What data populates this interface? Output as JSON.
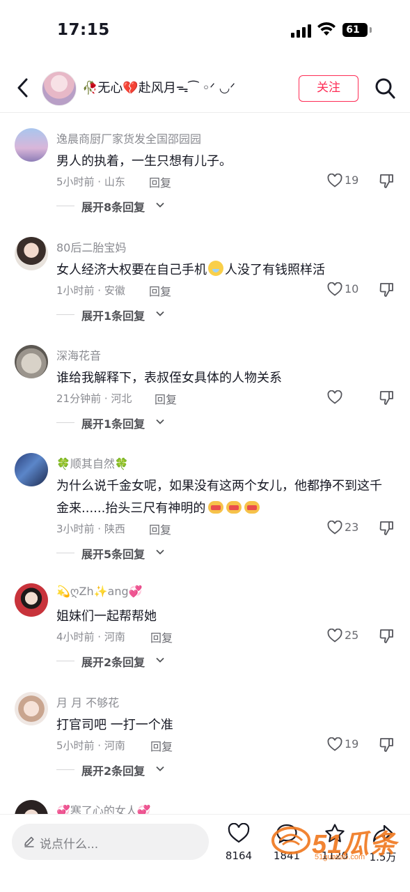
{
  "status_bar": {
    "time": "17:15",
    "battery": "61"
  },
  "header": {
    "user_name": "🥀无心💔赴风月ᯓ⁀ ◦ᐟ ◡ᐟ",
    "follow_label": "关注"
  },
  "comments": [
    {
      "name": "逸晨商厨厂家货发全国邵园园",
      "text": "男人的执着，一生只想有儿子。",
      "meta": "5小时前 · 山东",
      "reply": "回复",
      "likes": "19",
      "expand": "展开8条回复"
    },
    {
      "name": "80后二胎宝妈",
      "text_before": "女人经济大权要在自己手机",
      "text_after": "人没了有钱照样活",
      "meta": "1小时前 · 安徽",
      "reply": "回复",
      "likes": "10",
      "expand": "展开1条回复"
    },
    {
      "name": "深海花音",
      "text": "谁给我解释下，表叔侄女具体的人物关系",
      "meta": "21分钟前 · 河北",
      "reply": "回复",
      "likes": "",
      "expand": "展开1条回复"
    },
    {
      "name": "🍀顺其自然🍀",
      "text": "为什么说千金女呢，如果没有这两个女儿，他都挣不到这千金来......抬头三尺有神明的",
      "meta": "3小时前 · 陕西",
      "reply": "回复",
      "likes": "23",
      "expand": "展开5条回复"
    },
    {
      "name": "💫ღZh✨ang💞",
      "text": "姐妹们一起帮帮她",
      "meta": "4小时前 · 河南",
      "reply": "回复",
      "likes": "25",
      "expand": "展开2条回复"
    },
    {
      "name": "月 月 不够花",
      "text": "打官司吧 一打一个准",
      "meta": "5小时前 · 河南",
      "reply": "回复",
      "likes": "19",
      "expand": "展开2条回复"
    },
    {
      "name": "💞寒了心的女人💞"
    }
  ],
  "bottom_bar": {
    "input_placeholder": "说点什么...",
    "like_count": "8164",
    "comment_count": "1841",
    "favorite_count": "1120",
    "share_count": "1.5万"
  },
  "watermark": {
    "text": "51瓜条",
    "sub": "51guatiao.com"
  },
  "colors": {
    "accent": "#fe2c55",
    "secondary_text": "#8a8b91",
    "watermark": "#f07a22"
  }
}
